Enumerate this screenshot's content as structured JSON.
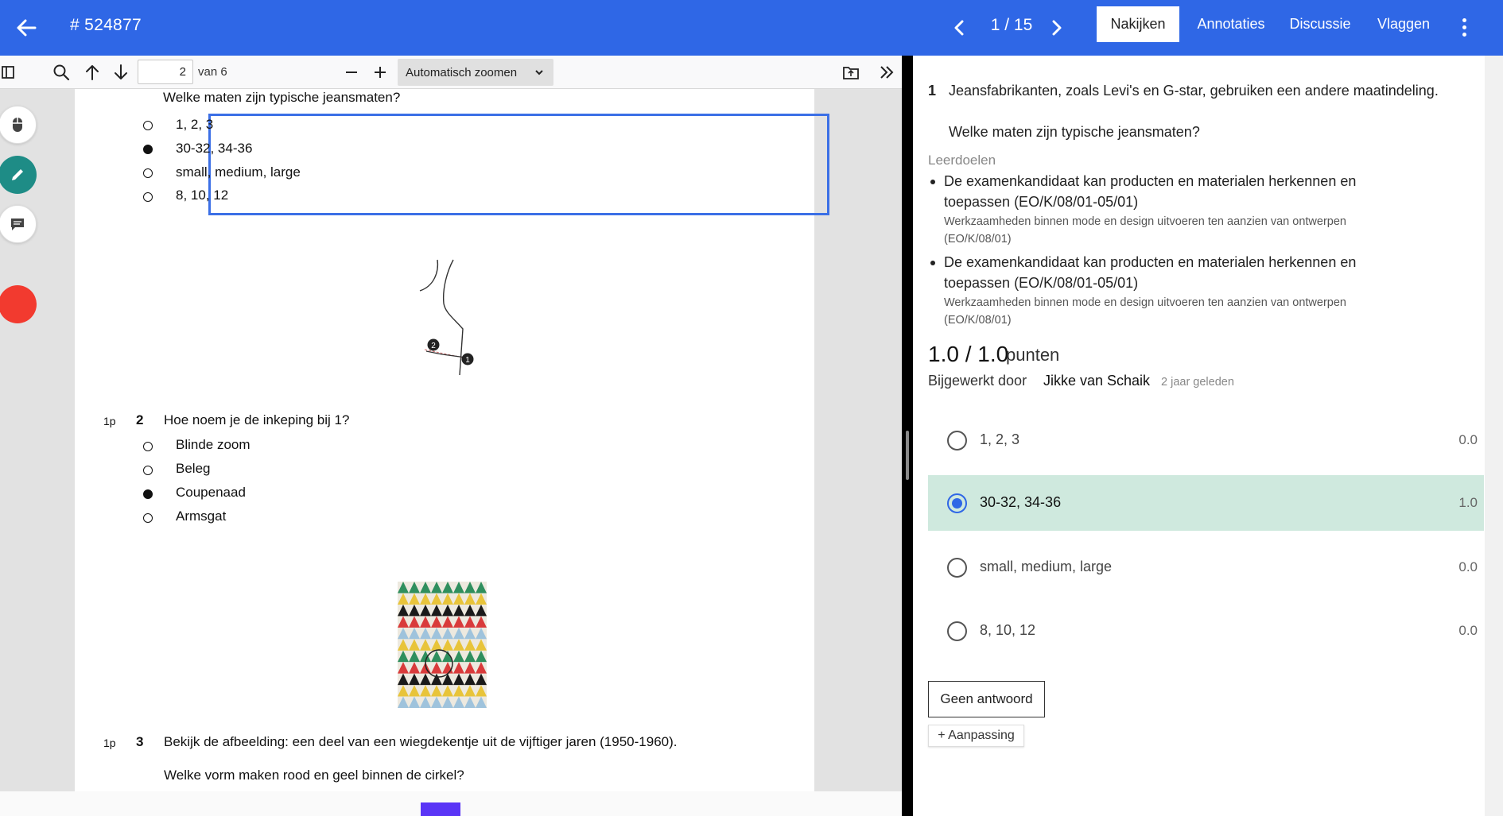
{
  "header": {
    "title": "# 524877",
    "pager": "1 / 15",
    "tabs": [
      {
        "label": "Nakijken",
        "active": true
      },
      {
        "label": "Annotaties",
        "active": false
      },
      {
        "label": "Discussie",
        "active": false
      },
      {
        "label": "Vlaggen",
        "active": false
      }
    ],
    "accent_color": "#2f67e6"
  },
  "pdf_toolbar": {
    "page_number": "2",
    "page_total_label": "van 6",
    "zoom_label": "Automatisch zoomen"
  },
  "pdf_page": {
    "q1_prompt": "Welke maten zijn typische jeansmaten?",
    "q1_options": [
      "1, 2, 3",
      "30-32, 34-36",
      "small, medium, large",
      "8, 10, 12"
    ],
    "q1_selected_index": 1,
    "figure1_labels": [
      "2",
      "1"
    ],
    "q2_points": "1p",
    "q2_number": "2",
    "q2_text": "Hoe noem je de inkeping bij 1?",
    "q2_options": [
      "Blinde zoom",
      "Beleg",
      "Coupenaad",
      "Armsgat"
    ],
    "q2_selected_index": 2,
    "q3_points": "1p",
    "q3_number": "3",
    "q3_text": "Bekijk de afbeelding: een deel van een wiegdekentje uit de vijftiger jaren (1950-1960).",
    "q3_subtext": "Welke vorm maken rood en geel binnen de cirkel?"
  },
  "right_panel": {
    "question_number": "1",
    "question_text": "Jeansfabrikanten, zoals Levi's en G-star, gebruiken een andere maatindeling.",
    "question_sub": "Welke maten zijn typische jeansmaten?",
    "leerdoelen_title": "Leerdoelen",
    "leerdoelen": [
      {
        "line1": "De examenkandidaat kan producten en materialen herkennen en",
        "line2": "toepassen (EO/K/08/01-05/01)",
        "sub1": "Werkzaamheden binnen mode en design uitvoeren ten aanzien van ontwerpen",
        "sub2": "(EO/K/08/01)"
      },
      {
        "line1": "De examenkandidaat kan producten en materialen herkennen en",
        "line2": "toepassen (EO/K/08/01-05/01)",
        "sub1": "Werkzaamheden binnen mode en design uitvoeren ten aanzien van ontwerpen",
        "sub2": "(EO/K/08/01)"
      }
    ],
    "score": "1.0 / 1.0",
    "score_unit": "punten",
    "updated_prefix": "Bijgewerkt door",
    "updated_by": "Jikke van Schaik",
    "updated_when": "2 jaar geleden",
    "options": [
      {
        "label": "1, 2, 3",
        "score": "0.0",
        "selected": false
      },
      {
        "label": "30-32, 34-36",
        "score": "1.0",
        "selected": true
      },
      {
        "label": "small, medium, large",
        "score": "0.0",
        "selected": false
      },
      {
        "label": "8, 10, 12",
        "score": "0.0",
        "selected": false
      }
    ],
    "no_answer_label": "Geen antwoord",
    "adjust_label": "+ Aanpassing",
    "selected_color": "#cfe9de"
  }
}
